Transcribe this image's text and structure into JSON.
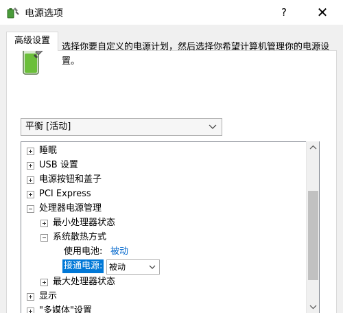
{
  "window": {
    "title": "电源选项",
    "help_label": "?",
    "close_label": "✕"
  },
  "tabs": [
    {
      "label": "高级设置"
    }
  ],
  "description": "选择你要自定义的电源计划，然后选择你希望计算机管理你的电源设置。",
  "plan_select": {
    "value": "平衡 [活动]"
  },
  "tree": {
    "items": [
      {
        "label": "睡眠",
        "state": "collapsed"
      },
      {
        "label": "USB 设置",
        "state": "collapsed"
      },
      {
        "label": "电源按钮和盖子",
        "state": "collapsed"
      },
      {
        "label": "PCI Express",
        "state": "collapsed"
      },
      {
        "label": "处理器电源管理",
        "state": "expanded"
      },
      {
        "label": "最小处理器状态",
        "state": "collapsed"
      },
      {
        "label": "系统散热方式",
        "state": "expanded"
      },
      {
        "label": "使用电池:",
        "value": "被动"
      },
      {
        "label": "接通电源:",
        "value": "被动"
      },
      {
        "label": "最大处理器状态",
        "state": "collapsed"
      },
      {
        "label": "显示",
        "state": "collapsed"
      },
      {
        "label": "\"多媒体\"设置",
        "state": "collapsed"
      }
    ]
  },
  "icons": {
    "app": "power-options-icon",
    "battery": "battery-power-icon"
  },
  "colors": {
    "selection": "#0078d7",
    "link": "#0066cc",
    "battery_fill": "#6bbf3a"
  }
}
